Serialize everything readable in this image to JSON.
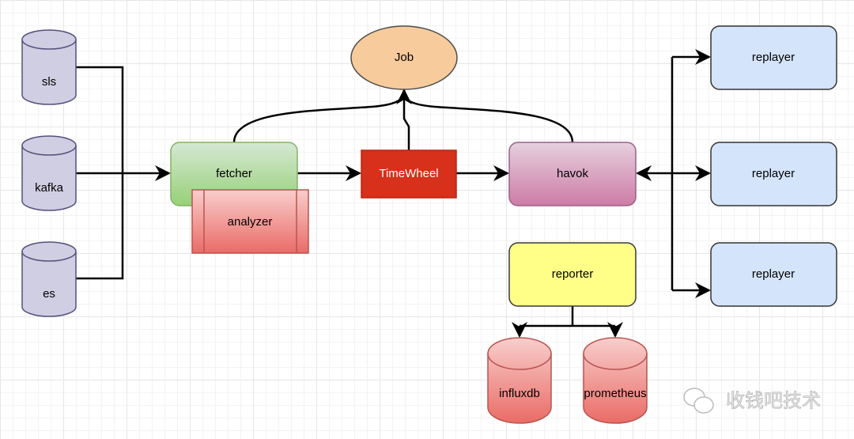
{
  "nodes": {
    "sls": "sls",
    "kafka": "kafka",
    "es": "es",
    "fetcher": "fetcher",
    "analyzer": "analyzer",
    "timewheel": "TimeWheel",
    "job": "Job",
    "havok": "havok",
    "replayer1": "replayer",
    "replayer2": "replayer",
    "replayer3": "replayer",
    "reporter": "reporter",
    "influxdb": "influxdb",
    "prometheus": "prometheus"
  },
  "watermark": "收钱吧技术",
  "colors": {
    "source_db": "#d0cee2",
    "fetcher": "#97d077",
    "analyzer": "#ea6b66",
    "timewheel": "#d7301b",
    "job": "#f7cb9b",
    "havok": "#cd7ba6",
    "replayer": "#d4e4fa",
    "reporter": "#ffff88",
    "sink_db": "#ea6b66"
  }
}
